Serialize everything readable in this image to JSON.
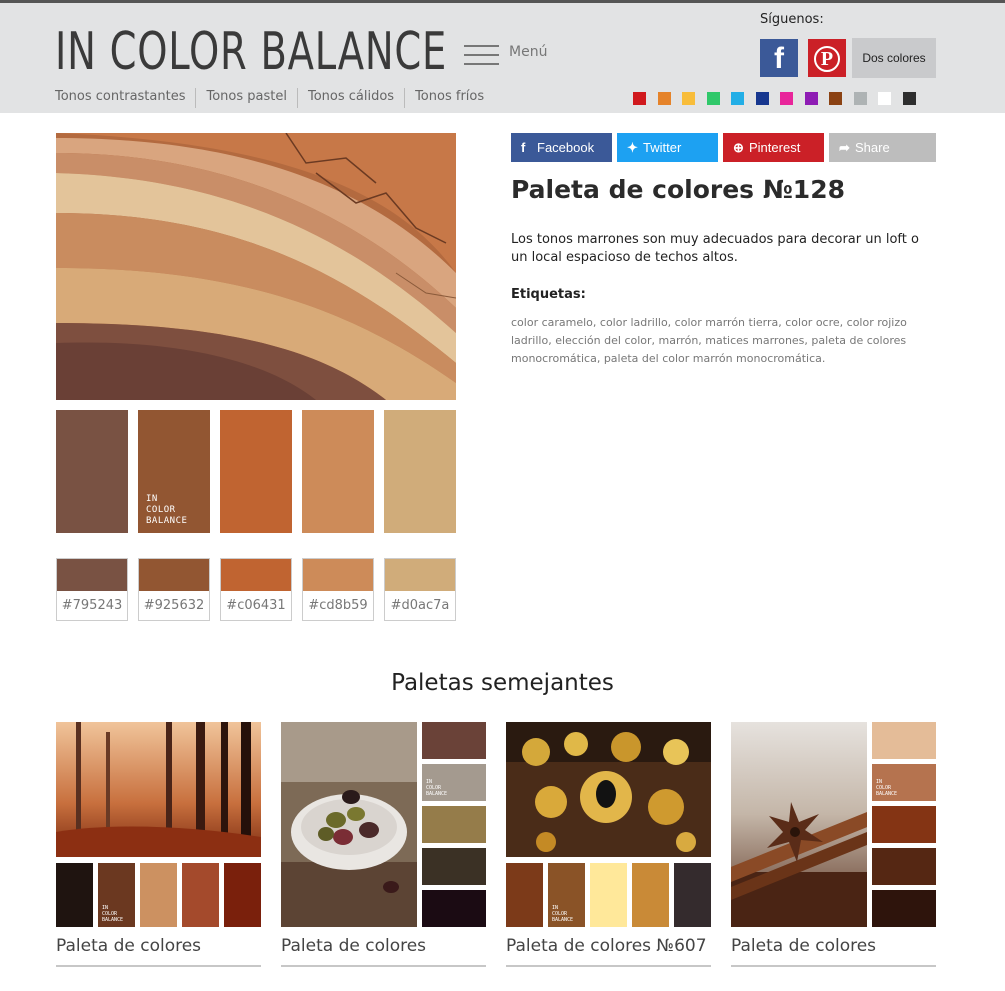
{
  "header": {
    "logo": "IN COLOR BALANCE",
    "menu_label": "Menú",
    "nav": [
      "Tonos contrastantes",
      "Tonos pastel",
      "Tonos cálidos",
      "Tonos fríos"
    ],
    "follow_label": "Síguenos:",
    "facebook_icon": "f",
    "pinterest_icon": "P",
    "dos_colores": "Dos colores",
    "color_filters": [
      "#d0191d",
      "#e5832a",
      "#f8bd3a",
      "#30c86a",
      "#22aee6",
      "#17378f",
      "#e8259a",
      "#8e1cb4",
      "#8b4213",
      "#aeb3b4",
      "#ffffff",
      "#2e2e2e"
    ]
  },
  "share": {
    "facebook": "Facebook",
    "twitter": "Twitter",
    "pinterest": "Pinterest",
    "share": "Share"
  },
  "palette": {
    "title": "Paleta de colores №128",
    "description": "Los tonos marrones son muy adecuados para decorar un loft o un local espacioso de techos altos.",
    "tags_heading": "Etiquetas:",
    "tags": "color caramelo, color ladrillo, color marrón tierra, color ocre, color rojizo ladrillo, elección del color, marrón, matices marrones, paleta de colores monocromática, paleta del color marrón monocromática.",
    "logo_text": "IN\nCOLOR\nBALANCE",
    "colors": [
      "#795243",
      "#925632",
      "#c06431",
      "#cd8b59",
      "#d0ac7a"
    ],
    "hex_labels": [
      "#795243",
      "#925632",
      "#c06431",
      "#cd8b59",
      "#d0ac7a"
    ]
  },
  "similar": {
    "title": "Paletas semejantes",
    "cards": [
      {
        "title": "Paleta de colores",
        "colors": [
          "#1f1410",
          "#6b3820",
          "#cc9161",
          "#a44a2c",
          "#7a200c"
        ]
      },
      {
        "title": "Paleta de colores",
        "colors": [
          "#6a4238",
          "#a49a8f",
          "#957c4a",
          "#3b3125",
          "#1b0b13"
        ]
      },
      {
        "title": "Paleta de colores №607",
        "colors": [
          "#7c3a19",
          "#8a5327",
          "#ffe89a",
          "#c98a37",
          "#342b2d"
        ]
      },
      {
        "title": "Paleta de colores",
        "colors": [
          "#e4bc98",
          "#b5734f",
          "#843414",
          "#552713",
          "#2e140c"
        ]
      }
    ]
  }
}
